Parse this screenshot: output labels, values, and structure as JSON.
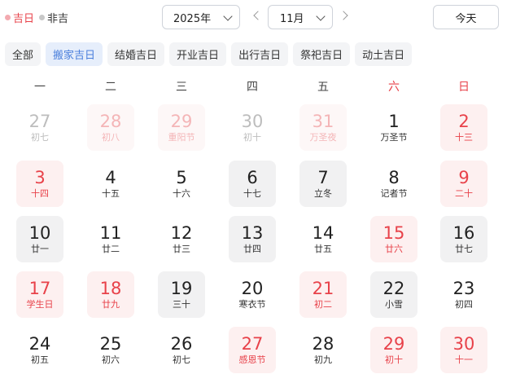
{
  "legend": {
    "good_label": "吉日",
    "bad_label": "非吉"
  },
  "year_select": {
    "value": "2025年"
  },
  "month_select": {
    "value": "11月"
  },
  "today_button": "今天",
  "filters": [
    {
      "label": "全部",
      "active": false
    },
    {
      "label": "搬家吉日",
      "active": true
    },
    {
      "label": "结婚吉日",
      "active": false
    },
    {
      "label": "开业吉日",
      "active": false
    },
    {
      "label": "出行吉日",
      "active": false
    },
    {
      "label": "祭祀吉日",
      "active": false
    },
    {
      "label": "动土吉日",
      "active": false
    }
  ],
  "weekdays": [
    "一",
    "二",
    "三",
    "四",
    "五",
    "六",
    "日"
  ],
  "days": [
    {
      "day": "27",
      "sub": "初七",
      "other": true,
      "red": false,
      "bg": "none"
    },
    {
      "day": "28",
      "sub": "初八",
      "other": true,
      "red": true,
      "bg": "pink"
    },
    {
      "day": "29",
      "sub": "重阳节",
      "other": true,
      "red": true,
      "bg": "pink"
    },
    {
      "day": "30",
      "sub": "初十",
      "other": true,
      "red": false,
      "bg": "none"
    },
    {
      "day": "31",
      "sub": "万圣夜",
      "other": true,
      "red": true,
      "bg": "pink"
    },
    {
      "day": "1",
      "sub": "万圣节",
      "other": false,
      "red": false,
      "bg": "none"
    },
    {
      "day": "2",
      "sub": "十三",
      "other": false,
      "red": true,
      "bg": "pink"
    },
    {
      "day": "3",
      "sub": "十四",
      "other": false,
      "red": true,
      "bg": "pink"
    },
    {
      "day": "4",
      "sub": "十五",
      "other": false,
      "red": false,
      "bg": "none"
    },
    {
      "day": "5",
      "sub": "十六",
      "other": false,
      "red": false,
      "bg": "none"
    },
    {
      "day": "6",
      "sub": "十七",
      "other": false,
      "red": false,
      "bg": "gray"
    },
    {
      "day": "7",
      "sub": "立冬",
      "other": false,
      "red": false,
      "bg": "gray"
    },
    {
      "day": "8",
      "sub": "记者节",
      "other": false,
      "red": false,
      "bg": "none"
    },
    {
      "day": "9",
      "sub": "二十",
      "other": false,
      "red": true,
      "bg": "pink"
    },
    {
      "day": "10",
      "sub": "廿一",
      "other": false,
      "red": false,
      "bg": "gray"
    },
    {
      "day": "11",
      "sub": "廿二",
      "other": false,
      "red": false,
      "bg": "none"
    },
    {
      "day": "12",
      "sub": "廿三",
      "other": false,
      "red": false,
      "bg": "none"
    },
    {
      "day": "13",
      "sub": "廿四",
      "other": false,
      "red": false,
      "bg": "gray"
    },
    {
      "day": "14",
      "sub": "廿五",
      "other": false,
      "red": false,
      "bg": "none"
    },
    {
      "day": "15",
      "sub": "廿六",
      "other": false,
      "red": true,
      "bg": "pink"
    },
    {
      "day": "16",
      "sub": "廿七",
      "other": false,
      "red": false,
      "bg": "gray"
    },
    {
      "day": "17",
      "sub": "学生日",
      "other": false,
      "red": true,
      "bg": "pink"
    },
    {
      "day": "18",
      "sub": "廿九",
      "other": false,
      "red": true,
      "bg": "pink"
    },
    {
      "day": "19",
      "sub": "三十",
      "other": false,
      "red": false,
      "bg": "gray"
    },
    {
      "day": "20",
      "sub": "寒衣节",
      "other": false,
      "red": false,
      "bg": "none"
    },
    {
      "day": "21",
      "sub": "初二",
      "other": false,
      "red": true,
      "bg": "pink"
    },
    {
      "day": "22",
      "sub": "小雪",
      "other": false,
      "red": false,
      "bg": "gray"
    },
    {
      "day": "23",
      "sub": "初四",
      "other": false,
      "red": false,
      "bg": "none"
    },
    {
      "day": "24",
      "sub": "初五",
      "other": false,
      "red": false,
      "bg": "none"
    },
    {
      "day": "25",
      "sub": "初六",
      "other": false,
      "red": false,
      "bg": "none"
    },
    {
      "day": "26",
      "sub": "初七",
      "other": false,
      "red": false,
      "bg": "none"
    },
    {
      "day": "27",
      "sub": "感恩节",
      "other": false,
      "red": true,
      "bg": "pink"
    },
    {
      "day": "28",
      "sub": "初九",
      "other": false,
      "red": false,
      "bg": "none"
    },
    {
      "day": "29",
      "sub": "初十",
      "other": false,
      "red": true,
      "bg": "pink"
    },
    {
      "day": "30",
      "sub": "十一",
      "other": false,
      "red": true,
      "bg": "pink"
    }
  ],
  "colors": {
    "accent_red": "#e8424a",
    "accent_blue": "#4a7fdc"
  }
}
